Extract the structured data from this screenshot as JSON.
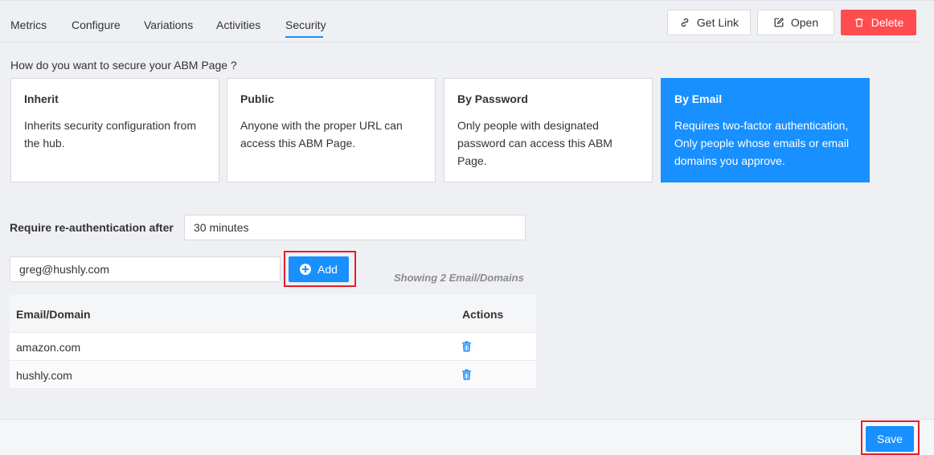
{
  "tabs": [
    {
      "label": "Metrics"
    },
    {
      "label": "Configure"
    },
    {
      "label": "Variations"
    },
    {
      "label": "Activities"
    },
    {
      "label": "Security"
    }
  ],
  "header_buttons": {
    "get_link": "Get Link",
    "open": "Open",
    "delete": "Delete"
  },
  "question": "How do you want to secure your ABM Page ?",
  "options": [
    {
      "title": "Inherit",
      "desc": "Inherits security configuration from the hub."
    },
    {
      "title": "Public",
      "desc": "Anyone with the proper URL can access this ABM Page."
    },
    {
      "title": "By Password",
      "desc": "Only people with designated password can access this ABM Page."
    },
    {
      "title": "By Email",
      "desc": "Requires two-factor authentication, Only people whose emails or email domains you approve."
    }
  ],
  "selected_option": "By Email",
  "reauth": {
    "label": "Require re-authentication after",
    "value": "30 minutes"
  },
  "email_input": {
    "value": "greg@hushly.com"
  },
  "add_label": "Add",
  "showing_text": "Showing 2 Email/Domains",
  "table": {
    "headers": [
      "Email/Domain",
      "Actions"
    ],
    "rows": [
      {
        "domain": "amazon.com",
        "action_icon": "trash-icon"
      },
      {
        "domain": "hushly.com",
        "action_icon": "trash-icon"
      }
    ]
  },
  "save_label": "Save",
  "colors": {
    "primary": "#1890ff",
    "danger": "#ff4d4f",
    "highlight": "#e0202a"
  }
}
